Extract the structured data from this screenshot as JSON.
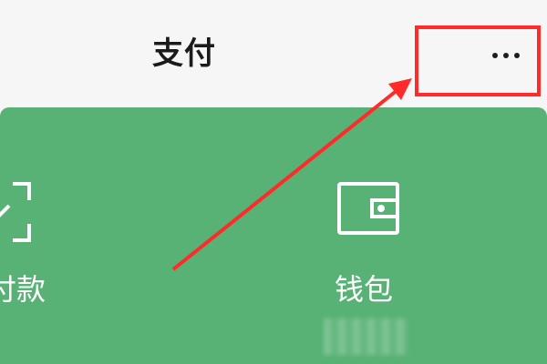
{
  "header": {
    "title": "支付",
    "more_icon": "more-horizontal-icon"
  },
  "panel": {
    "background_color": "#58b275",
    "tiles": [
      {
        "label": "付款",
        "icon": "scan-icon"
      },
      {
        "label": "钱包",
        "icon": "wallet-icon"
      }
    ]
  },
  "annotation": {
    "highlight_color": "#ff2a2a"
  }
}
